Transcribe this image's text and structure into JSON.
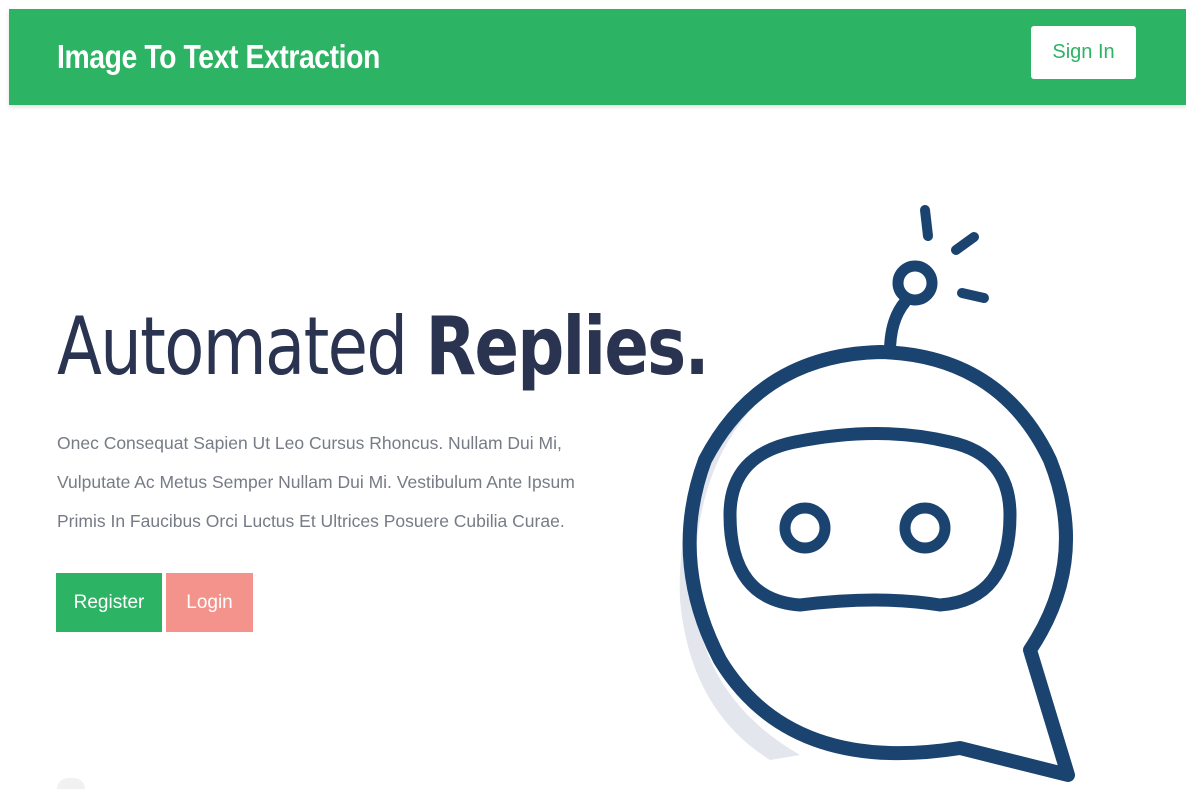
{
  "navbar": {
    "brand": "Image To Text Extraction",
    "signin_label": "Sign In"
  },
  "hero": {
    "title_light": "Automated ",
    "title_bold": "Replies.",
    "description": "Onec Consequat Sapien Ut Leo Cursus Rhoncus. Nullam Dui Mi, Vulputate Ac Metus Semper Nullam Dui Mi. Vestibulum Ante Ipsum Primis In Faucibus Orci Luctus Et Ultrices Posuere Cubilia Curae.",
    "register_label": "Register",
    "login_label": "Login"
  },
  "illustration": {
    "icon": "chatbot-robot-icon"
  },
  "colors": {
    "brand_green": "#2db364",
    "login_pink": "#f4938c",
    "dark_navy": "#2a3450",
    "robot_stroke": "#1b4370"
  }
}
